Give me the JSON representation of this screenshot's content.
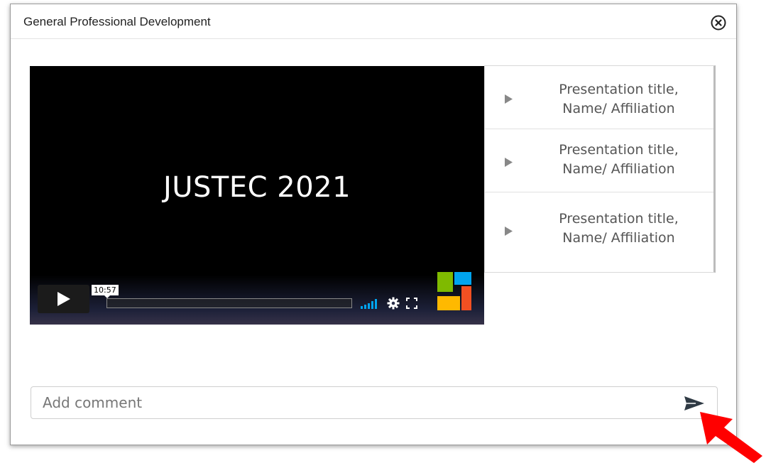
{
  "modal": {
    "title": "General Professional Development",
    "close_icon": "close-circle-icon"
  },
  "player": {
    "title_text": "JUSTEC 2021",
    "time": "10:57",
    "play_icon": "play-icon",
    "volume_icon": "volume-bars-icon",
    "settings_icon": "gear-icon",
    "fullscreen_icon": "fullscreen-icon",
    "logo_icon": "microsoft-stream-logo-icon",
    "logo_colors": [
      "#7fba00",
      "#00a4ef",
      "#ffb900",
      "#f25022"
    ],
    "accent_color": "#00a4ef"
  },
  "playlist": {
    "items": [
      {
        "line1": "Presentation title,",
        "line2": "Name/ Affiliation"
      },
      {
        "line1": "Presentation title,",
        "line2": "Name/ Affiliation"
      },
      {
        "line1": "Presentation title,",
        "line2": "Name/ Affiliation"
      }
    ],
    "item_icon": "play-triangle-icon"
  },
  "comment": {
    "placeholder": "Add comment",
    "send_icon": "send-arrow-icon"
  },
  "annotation": {
    "arrow_color": "#ff0000",
    "arrow_icon": "red-pointer-arrow-icon"
  }
}
